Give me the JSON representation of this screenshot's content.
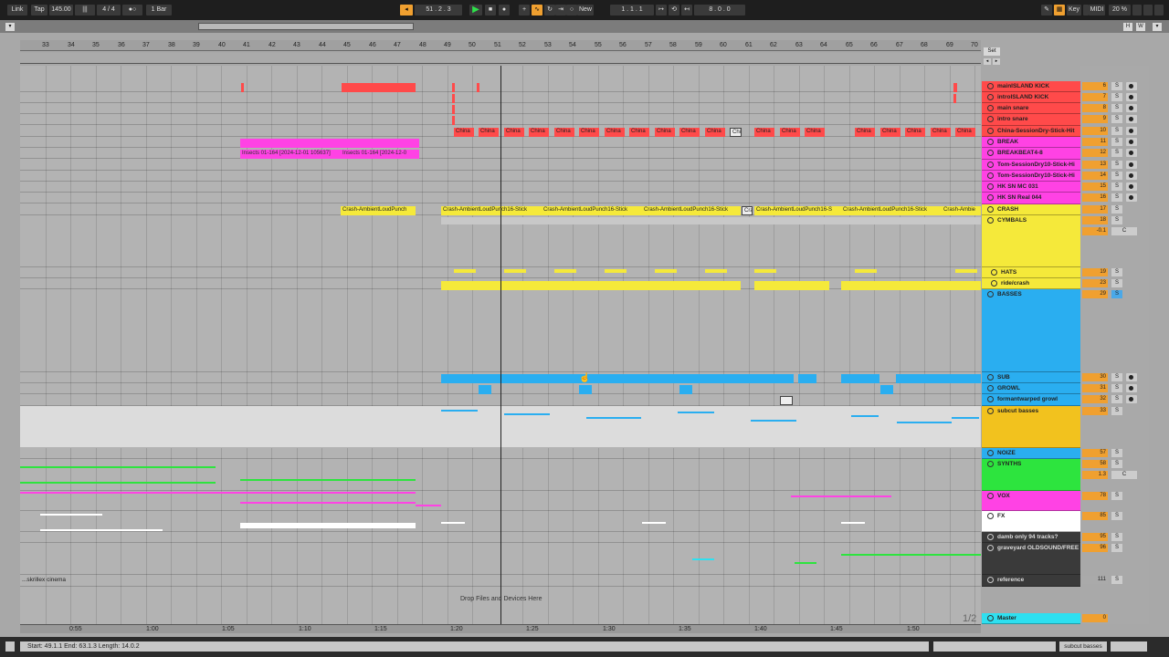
{
  "transport": {
    "link": "Link",
    "tap": "Tap",
    "tempo": "145.00",
    "time_sig": "4 / 4",
    "quantize": "1 Bar",
    "position": "51 .  2 .  3",
    "new_label": "New",
    "loop_pos": "1 .  1 .  1",
    "loop_len": "8 .  0 .  0",
    "key": "Key",
    "midi": "MIDI",
    "cpu": "20 %"
  },
  "ruler": [
    "33",
    "34",
    "35",
    "36",
    "37",
    "38",
    "39",
    "40",
    "41",
    "42",
    "43",
    "44",
    "45",
    "46",
    "47",
    "48",
    "49",
    "50",
    "51",
    "52",
    "53",
    "54",
    "55",
    "56",
    "57",
    "58",
    "59",
    "60",
    "61",
    "62",
    "63",
    "64",
    "65",
    "66",
    "67",
    "68",
    "69",
    "70"
  ],
  "timeline": [
    "0:55",
    "1:00",
    "1:05",
    "1:10",
    "1:15",
    "1:20",
    "1:25",
    "1:30",
    "1:35",
    "1:40",
    "1:45",
    "1:50"
  ],
  "set_label": "Set",
  "tracks": [
    {
      "name": "mainISLAND KICK",
      "num": "6",
      "color": "#ff4a4a"
    },
    {
      "name": "introISLAND KICK",
      "num": "7",
      "color": "#ff4a4a"
    },
    {
      "name": "main snare",
      "num": "8",
      "color": "#ff4a4a"
    },
    {
      "name": "intro snare",
      "num": "9",
      "color": "#ff4a4a"
    },
    {
      "name": "China-SessionDry-Stick-Hit",
      "num": "10",
      "color": "#ff4a4a"
    },
    {
      "name": "BREAK",
      "num": "11",
      "color": "#ff42e4"
    },
    {
      "name": "BREAKBEAT4-8",
      "num": "12",
      "color": "#ff42e4"
    },
    {
      "name": "Tom-SessionDry10-Stick-Hi",
      "num": "13",
      "color": "#ff42e4"
    },
    {
      "name": "Tom-SessionDry10-Stick-Hi",
      "num": "14",
      "color": "#ff42e4"
    },
    {
      "name": "HK SN MC 031",
      "num": "15",
      "color": "#ff42e4"
    },
    {
      "name": "HK SN Real 044",
      "num": "16",
      "color": "#ff42e4"
    },
    {
      "name": "CRASH",
      "num": "17",
      "color": "#f5e93a"
    },
    {
      "name": "CYMBALS",
      "num": "18",
      "color": "#f5e93a"
    },
    {
      "name": "HATS",
      "num": "19",
      "color": "#f5e93a"
    },
    {
      "name": "ride/crash",
      "num": "23",
      "color": "#f5e93a"
    },
    {
      "name": "BASSES",
      "num": "29",
      "color": "#2aaef0"
    },
    {
      "name": "SUB",
      "num": "30",
      "color": "#2aaef0"
    },
    {
      "name": "GROWL",
      "num": "31",
      "color": "#2aaef0"
    },
    {
      "name": "formantwarped growl",
      "num": "32",
      "color": "#2aaef0"
    },
    {
      "name": "subcut basses",
      "num": "33",
      "color": "#f2c21e"
    },
    {
      "name": "NOIZE",
      "num": "57",
      "color": "#2aaef0"
    },
    {
      "name": "SYNTHS",
      "num": "58",
      "color": "#2de43e"
    },
    {
      "name": "VOX",
      "num": "78",
      "color": "#ff42e4"
    },
    {
      "name": "FX",
      "num": "85",
      "color": "#ffffff"
    },
    {
      "name": "damb only 94 tracks?",
      "num": "95",
      "color": "#3a3a3a"
    },
    {
      "name": "graveyard OLDSOUND/FREE",
      "num": "96",
      "color": "#3a3a3a"
    },
    {
      "name": "reference",
      "num": "111",
      "color": "#3a3a3a"
    },
    {
      "name": "Master",
      "num": "0",
      "color": "#2ee0f0"
    }
  ],
  "clips": {
    "china": "China",
    "insects_a": "Insects 01-164 [2024-12-01 105637]",
    "insects_b": "Insects 01-164 [2024-12-0",
    "crash_a": "Crash-AmbientLoudPunch",
    "crash_b": "Crash-AmbientLoudPunch16-Stick",
    "crash_short": "Cra",
    "crash_c": "Crash-AmbientLoudPunch16-S",
    "crash_d": "Crash-Ambie"
  },
  "volume": {
    "cymbals": "-0.1",
    "synths": "1.3"
  },
  "drop_text": "Drop Files and Devices Here",
  "reference_prefix": "...skrillex cinema",
  "page_indicator": "1/2",
  "status": "Start: 49.1.1  End: 63.1.3  Length: 14.0.2",
  "selected_track": "subcut basses"
}
